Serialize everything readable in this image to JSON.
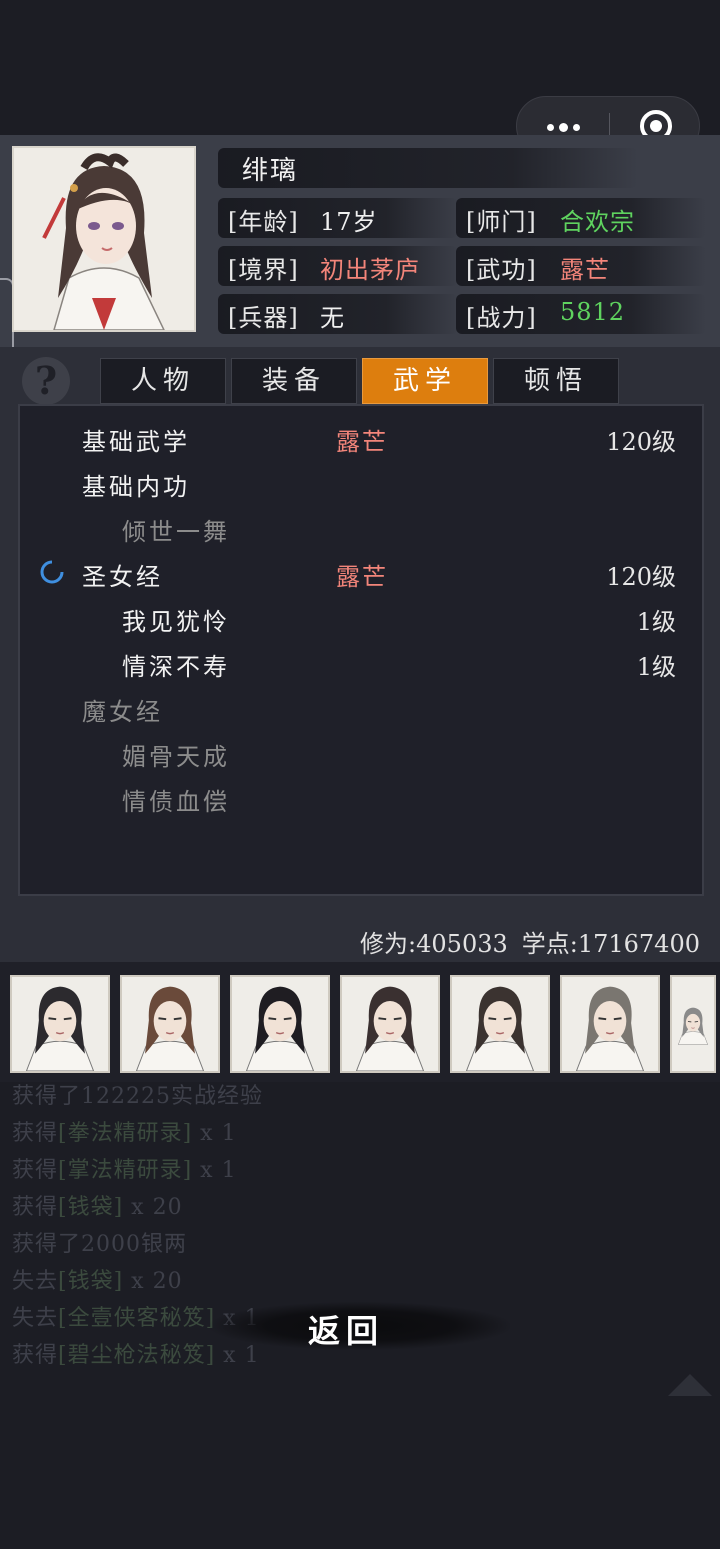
{
  "character": {
    "name": "绯璃",
    "fields": [
      {
        "label": "[年龄]",
        "value": "17岁",
        "color": "#f0f0f0"
      },
      {
        "label": "[师门]",
        "value": "合欢宗",
        "color": "#5fd35f"
      },
      {
        "label": "[境界]",
        "value": "初出茅庐",
        "color": "#f3857a"
      },
      {
        "label": "[武功]",
        "value": "露芒",
        "color": "#f3857a"
      },
      {
        "label": "[兵器]",
        "value": "无",
        "color": "#f0f0f0"
      },
      {
        "label": "[战力]",
        "value": "5812",
        "color": "#5fd35f"
      }
    ]
  },
  "tabs": [
    {
      "label": "人物",
      "active": false
    },
    {
      "label": "装备",
      "active": false
    },
    {
      "label": "武学",
      "active": true
    },
    {
      "label": "顿悟",
      "active": false
    }
  ],
  "skills": [
    {
      "name": "基础武学",
      "mark": "露芒",
      "level": "120级",
      "indent": 0,
      "dim": false
    },
    {
      "name": "基础内功",
      "mark": "",
      "level": "",
      "indent": 0,
      "dim": false
    },
    {
      "name": "倾世一舞",
      "mark": "",
      "level": "",
      "indent": 1,
      "dim": true
    },
    {
      "name": "圣女经",
      "mark": "露芒",
      "level": "120级",
      "indent": 0,
      "dim": false
    },
    {
      "name": "我见犹怜",
      "mark": "",
      "level": "1级",
      "indent": 1,
      "dim": false
    },
    {
      "name": "情深不寿",
      "mark": "",
      "level": "1级",
      "indent": 1,
      "dim": false
    },
    {
      "name": "魔女经",
      "mark": "",
      "level": "",
      "indent": 0,
      "dim": true
    },
    {
      "name": "媚骨天成",
      "mark": "",
      "level": "",
      "indent": 1,
      "dim": true
    },
    {
      "name": "情债血偿",
      "mark": "",
      "level": "",
      "indent": 1,
      "dim": true
    }
  ],
  "stats": {
    "cultivation": "修为:405033",
    "points": "学点:17167400"
  },
  "log": [
    {
      "prefix": "获得了122225实战经验",
      "item": "",
      "suffix": ""
    },
    {
      "prefix": "获得",
      "item": "[拳法精研录]",
      "suffix": " x 1"
    },
    {
      "prefix": "获得",
      "item": "[掌法精研录]",
      "suffix": " x 1"
    },
    {
      "prefix": "获得",
      "item": "[钱袋]",
      "suffix": " x 20"
    },
    {
      "prefix": "获得了2000银两",
      "item": "",
      "suffix": ""
    },
    {
      "prefix": "失去",
      "item": "[钱袋]",
      "suffix": " x 20"
    },
    {
      "prefix": "失去",
      "item": "[全壹侠客秘笈]",
      "suffix": " x 1"
    },
    {
      "prefix": "获得",
      "item": "[碧尘枪法秘笈]",
      "suffix": " x 1"
    }
  ],
  "return_label": "返回",
  "accent": "#dd7e0e"
}
